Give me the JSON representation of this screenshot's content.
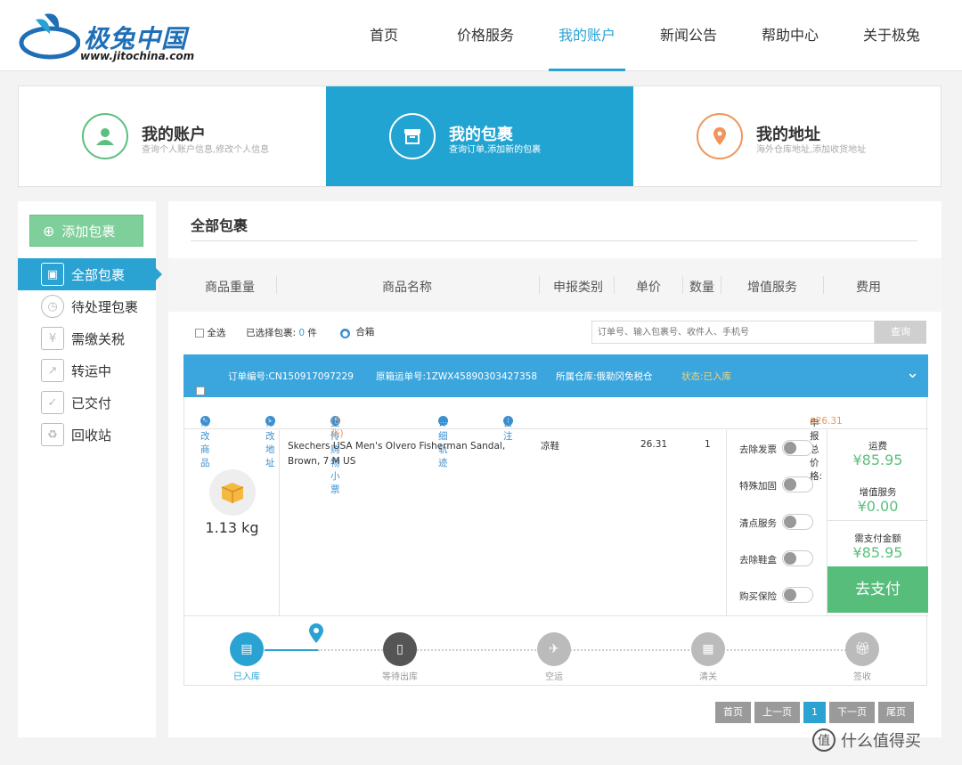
{
  "header": {
    "logo_text": "极兔中国",
    "logo_url": "www.jitochina.com",
    "nav": [
      "首页",
      "价格服务",
      "我的账户",
      "新闻公告",
      "帮助中心",
      "关于极兔"
    ],
    "active_nav": "我的账户"
  },
  "toptabs": [
    {
      "title": "我的账户",
      "sub": "查询个人账户信息,修改个人信息",
      "icon": "user-icon",
      "color": "#5bbf7f"
    },
    {
      "title": "我的包裹",
      "sub": "查询订单,添加新的包裹",
      "icon": "box-icon",
      "color": "#ffffff"
    },
    {
      "title": "我的地址",
      "sub": "海外仓库地址,添加收货地址",
      "icon": "location-pin-icon",
      "color": "#f0955a"
    }
  ],
  "sidebar": {
    "add_label": "添加包裹",
    "items": [
      {
        "label": "全部包裹",
        "icon": "package-icon"
      },
      {
        "label": "待处理包裹",
        "icon": "clock-icon"
      },
      {
        "label": "需缴关税",
        "icon": "yen-icon"
      },
      {
        "label": "转运中",
        "icon": "transit-icon"
      },
      {
        "label": "已交付",
        "icon": "check-icon"
      },
      {
        "label": "回收站",
        "icon": "recycle-icon"
      }
    ]
  },
  "main": {
    "title": "全部包裹",
    "columns": [
      "商品重量",
      "商品名称",
      "申报类别",
      "单价",
      "数量",
      "增值服务",
      "费用"
    ],
    "toolbar": {
      "select_all": "全选",
      "selected_prefix": "已选择包裹:",
      "selected_count": "0",
      "selected_unit": "件",
      "merge": "合箱",
      "search_placeholder": "订单号、输入包裹号、收件人、手机号",
      "search_btn": "查询"
    },
    "order": {
      "order_no": "订单编号:CN150917097229",
      "tracking": "原箱运单号:1ZWX45890303427358",
      "warehouse": "所属仓库:俄勒冈免税仓",
      "status": "状态:已入库",
      "actions": [
        "修改商品",
        "修改地址",
        "上传购物小票",
        "详细轨迹",
        "备注"
      ],
      "receipt_count": "(3张)",
      "declared_label": "申报总价格:",
      "declared_value": "$26.31",
      "weight": "1.13 kg",
      "product_name": "Skechers USA Men's Olvero Fisherman Sandal, Brown, 7 M US",
      "category": "凉鞋",
      "unit_price": "26.31",
      "qty": "1",
      "services": [
        "去除发票",
        "特殊加固",
        "清点服务",
        "去除鞋盒",
        "购买保险"
      ],
      "fee": {
        "shipping_label": "运费",
        "shipping": "¥85.95",
        "vas_label": "增值服务",
        "vas": "¥0.00",
        "total_label": "需支付金额",
        "total": "¥85.95",
        "pay_btn": "去支付"
      },
      "steps": [
        "已入库",
        "等待出库",
        "空运",
        "清关",
        "签收"
      ],
      "current_step": 0
    },
    "pager": [
      "首页",
      "上一页",
      "1",
      "下一页",
      "尾页"
    ]
  },
  "watermark": "什么值得买"
}
